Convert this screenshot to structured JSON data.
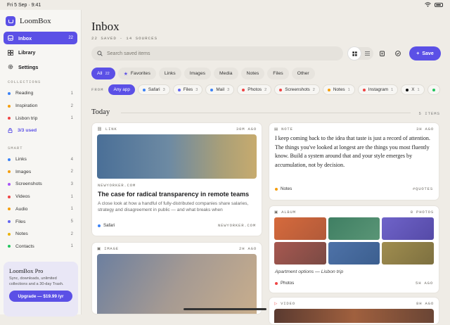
{
  "status": {
    "time": "Fri 5 Sep · 9:41"
  },
  "brand": "LoomBox",
  "nav": [
    {
      "label": "Inbox",
      "count": "22"
    },
    {
      "label": "Library",
      "count": ""
    },
    {
      "label": "Settings",
      "count": ""
    }
  ],
  "collections_header": "COLLECTIONS",
  "collections": [
    {
      "label": "Reading",
      "count": "1",
      "color": "#3b82f6"
    },
    {
      "label": "Inspiration",
      "count": "2",
      "color": "#f59e0b"
    },
    {
      "label": "Lisbon trip",
      "count": "1",
      "color": "#ef4444"
    }
  ],
  "used": "3/3 used",
  "smart_header": "SMART",
  "smart": [
    {
      "label": "Links",
      "count": "4",
      "color": "#3b82f6"
    },
    {
      "label": "Images",
      "count": "2",
      "color": "#f59e0b"
    },
    {
      "label": "Screenshots",
      "count": "3",
      "color": "#a855f7"
    },
    {
      "label": "Videos",
      "count": "1",
      "color": "#ef4444"
    },
    {
      "label": "Audio",
      "count": "1",
      "color": "#f59e0b"
    },
    {
      "label": "Files",
      "count": "5",
      "color": "#6366f1"
    },
    {
      "label": "Notes",
      "count": "2",
      "color": "#eab308"
    },
    {
      "label": "Contacts",
      "count": "1",
      "color": "#22c55e"
    }
  ],
  "promo": {
    "title": "LoomBox Pro",
    "text": "Sync, downloads, unlimited collections and a 30-day Trash.",
    "button": "Upgrade — $19.99 /yr"
  },
  "main": {
    "title": "Inbox",
    "subtitle": "22 SAVED · 14 SOURCES",
    "search_placeholder": "Search saved items",
    "save": "Save"
  },
  "filters": [
    {
      "label": "All",
      "count": "22"
    },
    {
      "label": "Favorites",
      "count": ""
    },
    {
      "label": "Links",
      "count": ""
    },
    {
      "label": "Images",
      "count": ""
    },
    {
      "label": "Media",
      "count": ""
    },
    {
      "label": "Notes",
      "count": ""
    },
    {
      "label": "Files",
      "count": ""
    },
    {
      "label": "Other",
      "count": ""
    }
  ],
  "from_label": "FROM",
  "sources": [
    {
      "label": "Any app",
      "count": "",
      "color": ""
    },
    {
      "label": "Safari",
      "count": "3",
      "color": "#3b82f6"
    },
    {
      "label": "Files",
      "count": "3",
      "color": "#6366f1"
    },
    {
      "label": "Mail",
      "count": "3",
      "color": "#3b82f6"
    },
    {
      "label": "Photos",
      "count": "2",
      "color": "#ef4444"
    },
    {
      "label": "Screenshots",
      "count": "2",
      "color": "#ef4444"
    },
    {
      "label": "Notes",
      "count": "1",
      "color": "#f59e0b"
    },
    {
      "label": "Instagram",
      "count": "1",
      "color": "#ef4444"
    },
    {
      "label": "X",
      "count": "1",
      "color": "#111111"
    }
  ],
  "section": {
    "title": "Today",
    "count": "5 ITEMS"
  },
  "cards": {
    "link": {
      "type": "LINK",
      "time": "30M AGO",
      "domain": "NEWYORKER.COM",
      "title": "The case for radical transparency in remote teams",
      "desc": "A close look at how a handful of fully-distributed companies share salaries, strategy and disagreement in public — and what breaks when",
      "source": "Safari",
      "domain2": "NEWYORKER.COM"
    },
    "note": {
      "type": "NOTE",
      "time": "3H AGO",
      "text": "I keep coming back to the idea that taste is just a record of attention. The things you've looked at longest are the things you most fluently know. Build a system around that and your style emerges by accumulation, not by decision.",
      "source": "Notes",
      "tag": "#QUOTES"
    },
    "album": {
      "type": "ALBUM",
      "count": "8 PHOTOS",
      "caption": "Apartment options — Lisbon trip",
      "source": "Photos",
      "time": "5H AGO"
    },
    "image": {
      "type": "IMAGE",
      "time": "2H AGO"
    },
    "video": {
      "type": "VIDEO",
      "time": "8H AGO"
    }
  }
}
